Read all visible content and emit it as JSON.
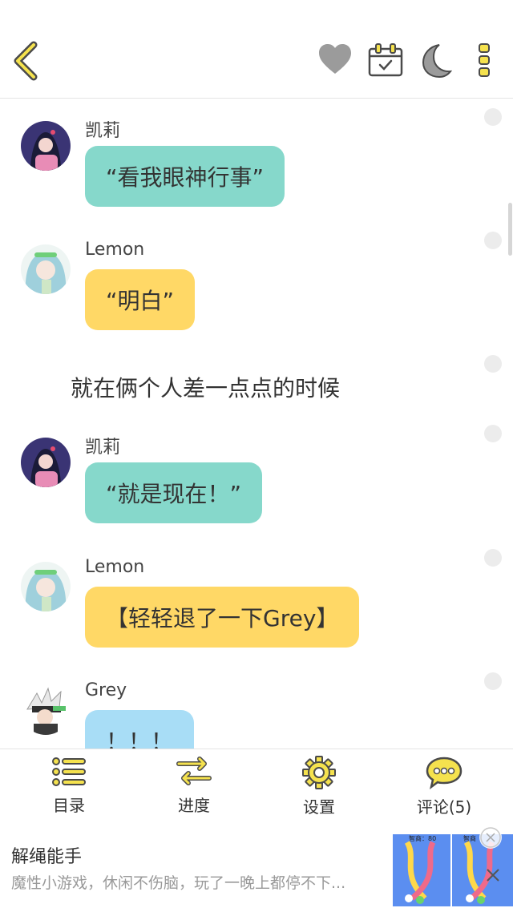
{
  "colors": {
    "accent": "#f5e24e",
    "icon_stroke": "#4a4a4a",
    "bubble_teal": "#86d8cb",
    "bubble_yellow": "#ffd866",
    "bubble_blue": "#a8ddf6"
  },
  "header": {
    "icons": [
      "back-icon",
      "heart-icon",
      "calendar-check-icon",
      "moon-icon",
      "more-vertical-icon"
    ]
  },
  "chat": [
    {
      "type": "message",
      "sender": "凯莉",
      "text": "“看我眼神行事”",
      "bubble": "teal"
    },
    {
      "type": "message",
      "sender": "Lemon",
      "text": "“明白”",
      "bubble": "yellow"
    },
    {
      "type": "narration",
      "text": "就在俩个人差一点点的时候"
    },
    {
      "type": "message",
      "sender": "凯莉",
      "text": "“就是现在！”",
      "bubble": "teal"
    },
    {
      "type": "message",
      "sender": "Lemon",
      "text": "【轻轻退了一下Grey】",
      "bubble": "yellow"
    },
    {
      "type": "message",
      "sender": "Grey",
      "text": "！！！",
      "bubble": "blue"
    }
  ],
  "toolbar": {
    "catalog": "目录",
    "progress": "进度",
    "settings": "设置",
    "comments": "评论(5)"
  },
  "ad": {
    "title": "解绳能手",
    "description": "魔性小游戏，休闲不伤脑，玩了一晚上都停不下...",
    "image_caption_1": "智商：80",
    "image_caption_2": "智商"
  }
}
